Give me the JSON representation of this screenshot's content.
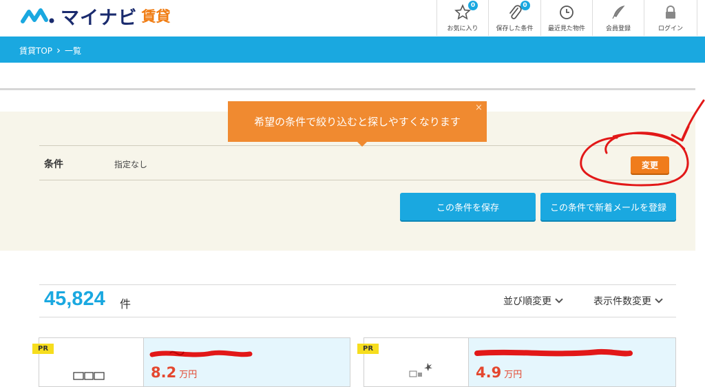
{
  "logo": {
    "brand": "マイナビ",
    "suffix": "賃貸"
  },
  "nav": [
    {
      "label": "お気に入り",
      "icon": "star-icon",
      "badge": "0"
    },
    {
      "label": "保存した条件",
      "icon": "paperclip-icon",
      "badge": "0"
    },
    {
      "label": "最近見た物件",
      "icon": "clock-icon"
    },
    {
      "label": "会員登録",
      "icon": "pen-icon"
    },
    {
      "label": "ログイン",
      "icon": "lock-icon"
    }
  ],
  "breadcrumb": {
    "home": "賃貸TOP",
    "separator": "›",
    "current": "一覧"
  },
  "tooltip": {
    "text": "希望の条件で絞り込むと探しやすくなります",
    "close": "×"
  },
  "condition": {
    "label": "条件",
    "value": "指定なし",
    "change_button": "変更"
  },
  "buttons": {
    "save": "この条件を保存",
    "mail": "この条件で新着メールを登録"
  },
  "results": {
    "count": "45,824",
    "unit": "件",
    "sort": "並び順変更",
    "per_page": "表示件数変更"
  },
  "cards": [
    {
      "tag": "PR",
      "price": "8.2",
      "unit": "万円"
    },
    {
      "tag": "PR",
      "price": "4.9",
      "unit": "万円"
    }
  ],
  "colors": {
    "accent_blue": "#1aa8e0",
    "accent_orange": "#f07c1b",
    "annotation_red": "#e21818"
  }
}
